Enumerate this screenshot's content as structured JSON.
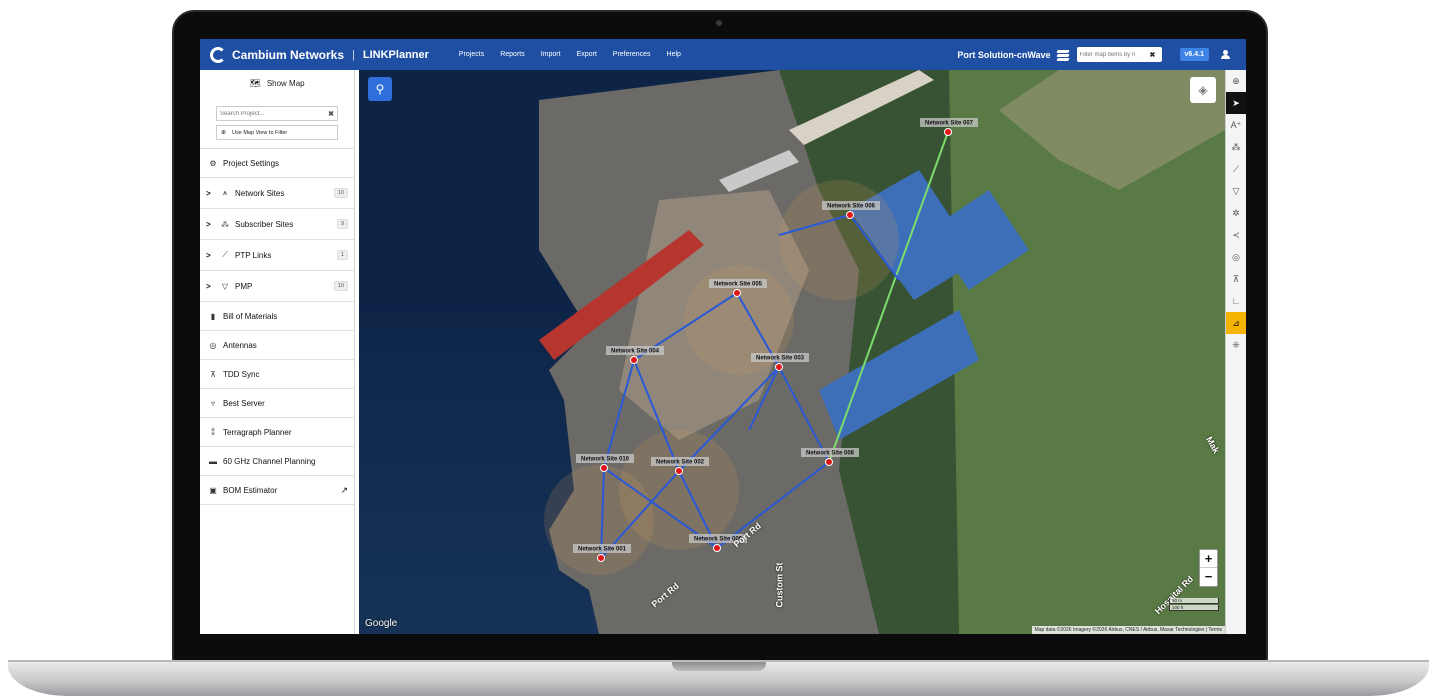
{
  "app": {
    "brand": "Cambium Networks",
    "separator": "|",
    "product": "LINKPlanner",
    "menu": [
      "Projects",
      "Reports",
      "Import",
      "Export",
      "Preferences",
      "Help"
    ],
    "project_name": "Port Solution-cnWave",
    "filter_placeholder": "Filter map items by n",
    "version": "v6.4.1"
  },
  "sidebar": {
    "show_map": "Show Map",
    "search_placeholder": "Search Project...",
    "map_filter": "Use Map View to Filter",
    "items": [
      {
        "label": "Project Settings",
        "icon": "gear-icon"
      },
      {
        "label": "Network Sites",
        "icon": "tower-icon",
        "count": "10",
        "caret": ">"
      },
      {
        "label": "Subscriber Sites",
        "icon": "subscriber-icon",
        "count": "9",
        "caret": ">"
      },
      {
        "label": "PTP Links",
        "icon": "link-icon",
        "count": "1",
        "caret": ">"
      },
      {
        "label": "PMP",
        "icon": "pmp-icon",
        "count": "10",
        "caret": ">"
      },
      {
        "label": "Bill of Materials",
        "icon": "document-icon"
      },
      {
        "label": "Antennas",
        "icon": "antenna-icon"
      },
      {
        "label": "TDD Sync",
        "icon": "tdd-icon"
      },
      {
        "label": "Best Server",
        "icon": "best-server-icon"
      },
      {
        "label": "Terragraph Planner",
        "icon": "terragraph-icon"
      },
      {
        "label": "60 GHz Channel Planning",
        "icon": "channel-icon"
      },
      {
        "label": "BOM Estimator",
        "icon": "estimator-icon"
      }
    ]
  },
  "map": {
    "sites": [
      {
        "label": "Network Site 001"
      },
      {
        "label": "Network Site 002"
      },
      {
        "label": "Network Site 003"
      },
      {
        "label": "Network Site 004"
      },
      {
        "label": "Network Site 005"
      },
      {
        "label": "Network Site 006"
      },
      {
        "label": "Network Site 007"
      },
      {
        "label": "Network Site 008"
      },
      {
        "label": "Network Site 009"
      },
      {
        "label": "Network Site 010"
      }
    ],
    "roads": [
      "Port Rd",
      "Port Rd",
      "Custom St",
      "Hospital Rd",
      "Mak"
    ],
    "google": "Google",
    "attribution": "Map data ©2026 Imagery ©2026 Airbus, CNES / Airbus, Maxar Technologies | Terms",
    "scale": [
      "50 m",
      "100 ft"
    ],
    "leaflet": "Leaflet",
    "link_color": "#2a59d8",
    "ptp_color": "#7bdc6b",
    "site_color": "#e0161b"
  },
  "colors": {
    "topbar": "#1f4fa3",
    "accent": "#f4b400"
  }
}
